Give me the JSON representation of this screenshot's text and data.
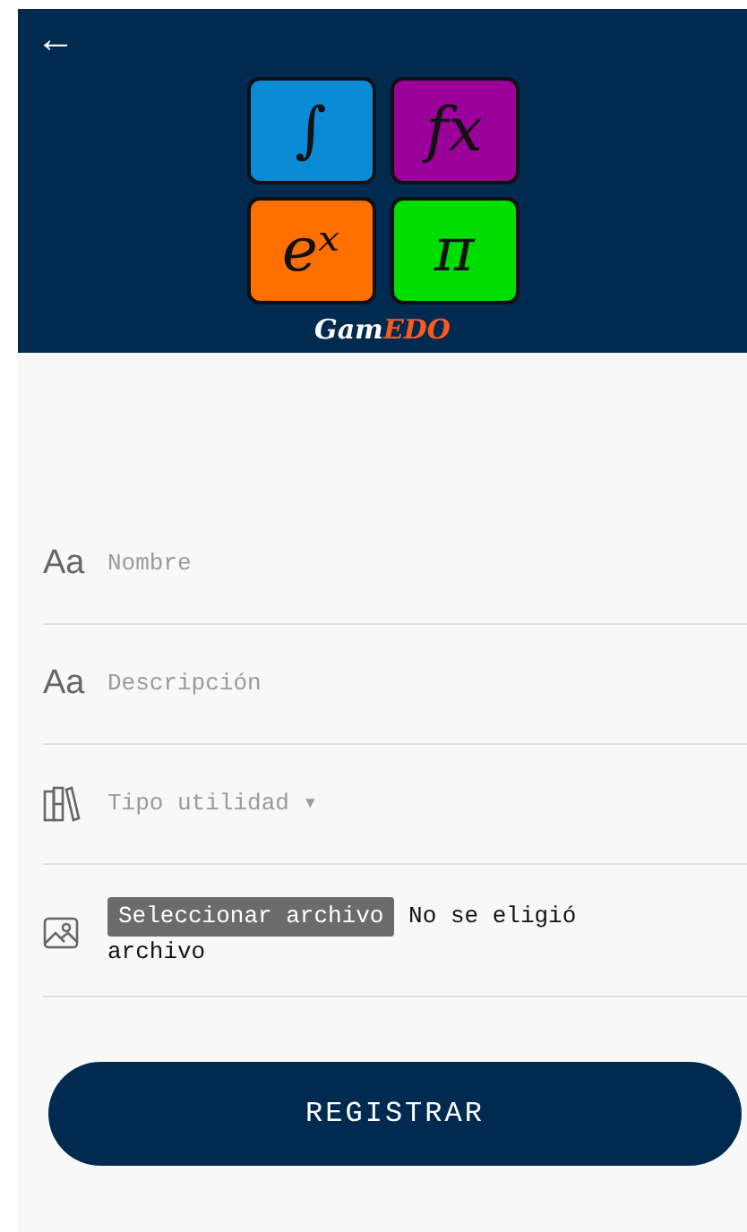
{
  "header": {
    "back": "←",
    "logo": {
      "tiles": [
        {
          "symbol": "∫",
          "color": "#0b8ad6"
        },
        {
          "symbol": "fx",
          "color": "#9b009b"
        },
        {
          "symbol": "eˣ",
          "color": "#ff7000"
        },
        {
          "symbol": "π",
          "color": "#00dd00"
        }
      ],
      "name": [
        {
          "text": "Gam",
          "color": "#ffffff"
        },
        {
          "text": "EDO",
          "color": "#ff5a1e"
        }
      ]
    }
  },
  "form": {
    "fields": [
      {
        "kind": "text",
        "icon_text": "Aa",
        "placeholder": "Nombre"
      },
      {
        "kind": "text",
        "icon_text": "Aa",
        "placeholder": "Descripción"
      },
      {
        "kind": "select",
        "placeholder": "Tipo utilidad",
        "caret": "▾"
      },
      {
        "kind": "file",
        "button": "Seleccionar archivo",
        "status": "No se eligió archivo"
      }
    ],
    "submit": "REGISTRAR"
  }
}
